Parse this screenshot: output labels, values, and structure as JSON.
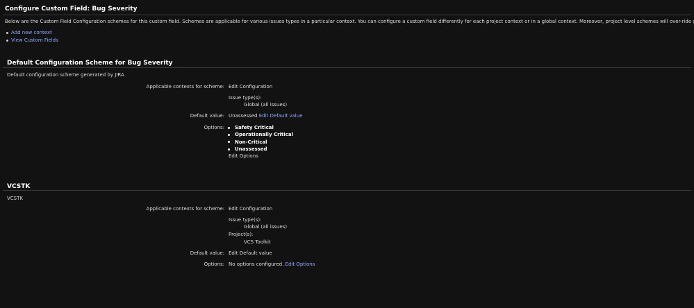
{
  "page": {
    "title": "Configure Custom Field: Bug Severity",
    "intro": "Below are the Custom Field Configuration schemes for this custom field. Schemes are applicable for various issues types in a particular context. You can configure a custom field differently for each project context or in a global context. Moreover, project level schemes will over-ride global ones.",
    "actions": [
      {
        "label": "Add new context"
      },
      {
        "label": "View Custom Fields"
      }
    ]
  },
  "schemes": [
    {
      "title": "Default Configuration Scheme for Bug Severity",
      "description": "Default configuration scheme generated by JIRA",
      "contexts_label": "Applicable contexts for scheme:",
      "edit_configuration": "Edit Configuration",
      "issue_types_label": "Issue type(s):",
      "issue_types_value": "Global (all issues)",
      "default_label": "Default value:",
      "default_value": "Unassessed",
      "edit_default": "Edit Default value",
      "options_label": "Options:",
      "options": [
        "Safety Critical",
        "Operationally Critical",
        "Non-Critical",
        "Unassessed"
      ],
      "edit_options": "Edit Options"
    },
    {
      "title": "VCSTK",
      "description": "VCSTK",
      "contexts_label": "Applicable contexts for scheme:",
      "edit_configuration": "Edit Configuration",
      "issue_types_label": "Issue type(s):",
      "issue_types_value": "Global (all issues)",
      "projects_label": "Project(s):",
      "projects_value": "VCS Toolkit",
      "default_label": "Default value:",
      "edit_default": "Edit Default value",
      "options_label": "Options:",
      "no_options": "No options configured.",
      "edit_options": "Edit Options"
    }
  ]
}
